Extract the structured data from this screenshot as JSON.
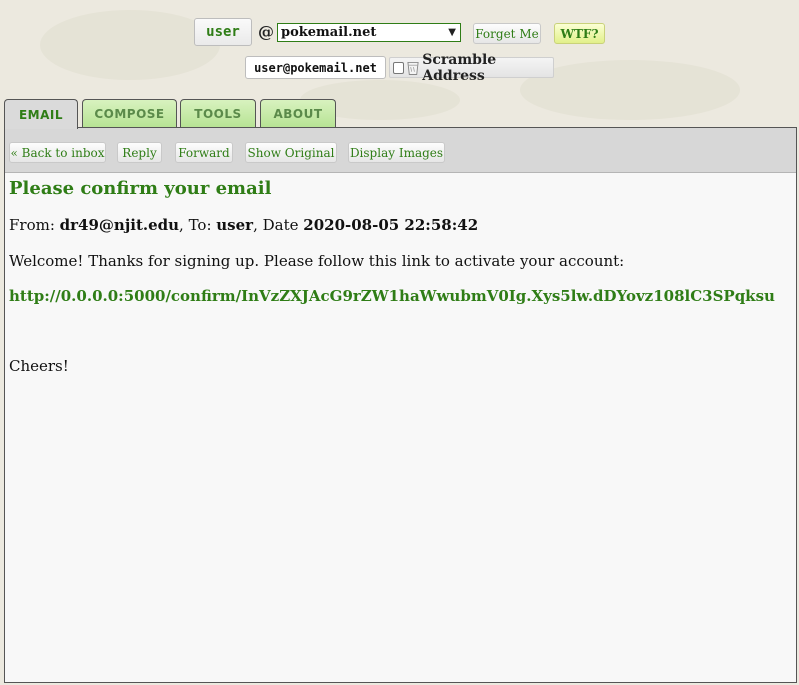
{
  "header": {
    "username": "user",
    "at_symbol": "@",
    "domain_selected": "pokemail.net",
    "forget_button": "Forget Me",
    "wtf_button": "WTF?",
    "full_address": "user@pokemail.net",
    "scramble_label": "Scramble Address",
    "scramble_checked": false
  },
  "tabs": [
    {
      "label": "EMAIL",
      "active": true
    },
    {
      "label": "COMPOSE",
      "active": false
    },
    {
      "label": "TOOLS",
      "active": false
    },
    {
      "label": "ABOUT",
      "active": false
    }
  ],
  "toolbar": {
    "back": "« Back to inbox",
    "reply": "Reply",
    "forward": "Forward",
    "show_original": "Show Original",
    "display_images": "Display Images"
  },
  "email": {
    "subject": "Please confirm your email",
    "from_label": "From: ",
    "from": "dr49@njit.edu",
    "to_label": ", To: ",
    "to": "user",
    "date_label": ", Date ",
    "date": "2020-08-05 22:58:42",
    "welcome": "Welcome! Thanks for signing up. Please follow this link to activate your account:",
    "link": "http://0.0.0.0:5000/confirm/InVzZXJAcG9rZW1haWwubmV0Ig.Xys5lw.dDYovz108lC3SPqksu",
    "signoff": "Cheers!"
  },
  "colors": {
    "accent_green": "#2f7d16",
    "tab_green": "#b6e393",
    "panel_bg": "#f8f8f8",
    "toolbar_bg": "#d7d7d7"
  }
}
